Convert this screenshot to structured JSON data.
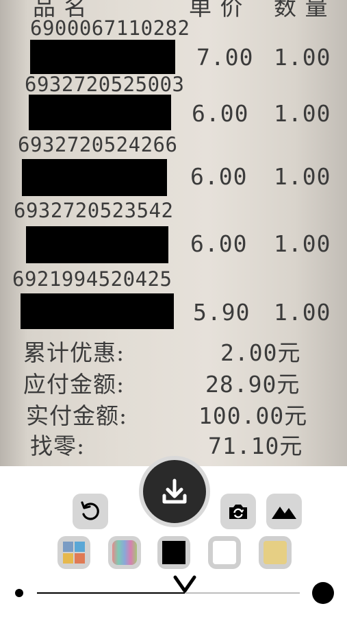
{
  "receipt": {
    "header": {
      "name": "品 名",
      "price": "单 价",
      "qty": "数 量"
    },
    "items": [
      {
        "barcode": "6900067110282",
        "price": "7.00",
        "qty": "1.00"
      },
      {
        "barcode": "6932720525003",
        "price": "6.00",
        "qty": "1.00"
      },
      {
        "barcode": "6932720524266",
        "price": "6.00",
        "qty": "1.00"
      },
      {
        "barcode": "6932720523542",
        "price": "6.00",
        "qty": "1.00"
      },
      {
        "barcode": "6921994520425",
        "price": "5.90",
        "qty": "1.00"
      }
    ],
    "totals": [
      {
        "label": "累计优惠:",
        "value": "2.00元"
      },
      {
        "label": "应付金额:",
        "value": "28.90元"
      },
      {
        "label": "实付金额:",
        "value": "100.00元"
      },
      {
        "label": "找零:",
        "value": "71.10元"
      }
    ]
  },
  "toolbar": {
    "save": "download-icon",
    "undo": "rotate-left-icon",
    "retake": "camera-rotate-icon",
    "enhance": "mountain-icon"
  },
  "filters": [
    "original",
    "color",
    "black",
    "white",
    "paper"
  ],
  "colors": {
    "accent": "#2a2a2a",
    "button_bg": "#d6d6d6",
    "paper": "#e6e1da"
  }
}
